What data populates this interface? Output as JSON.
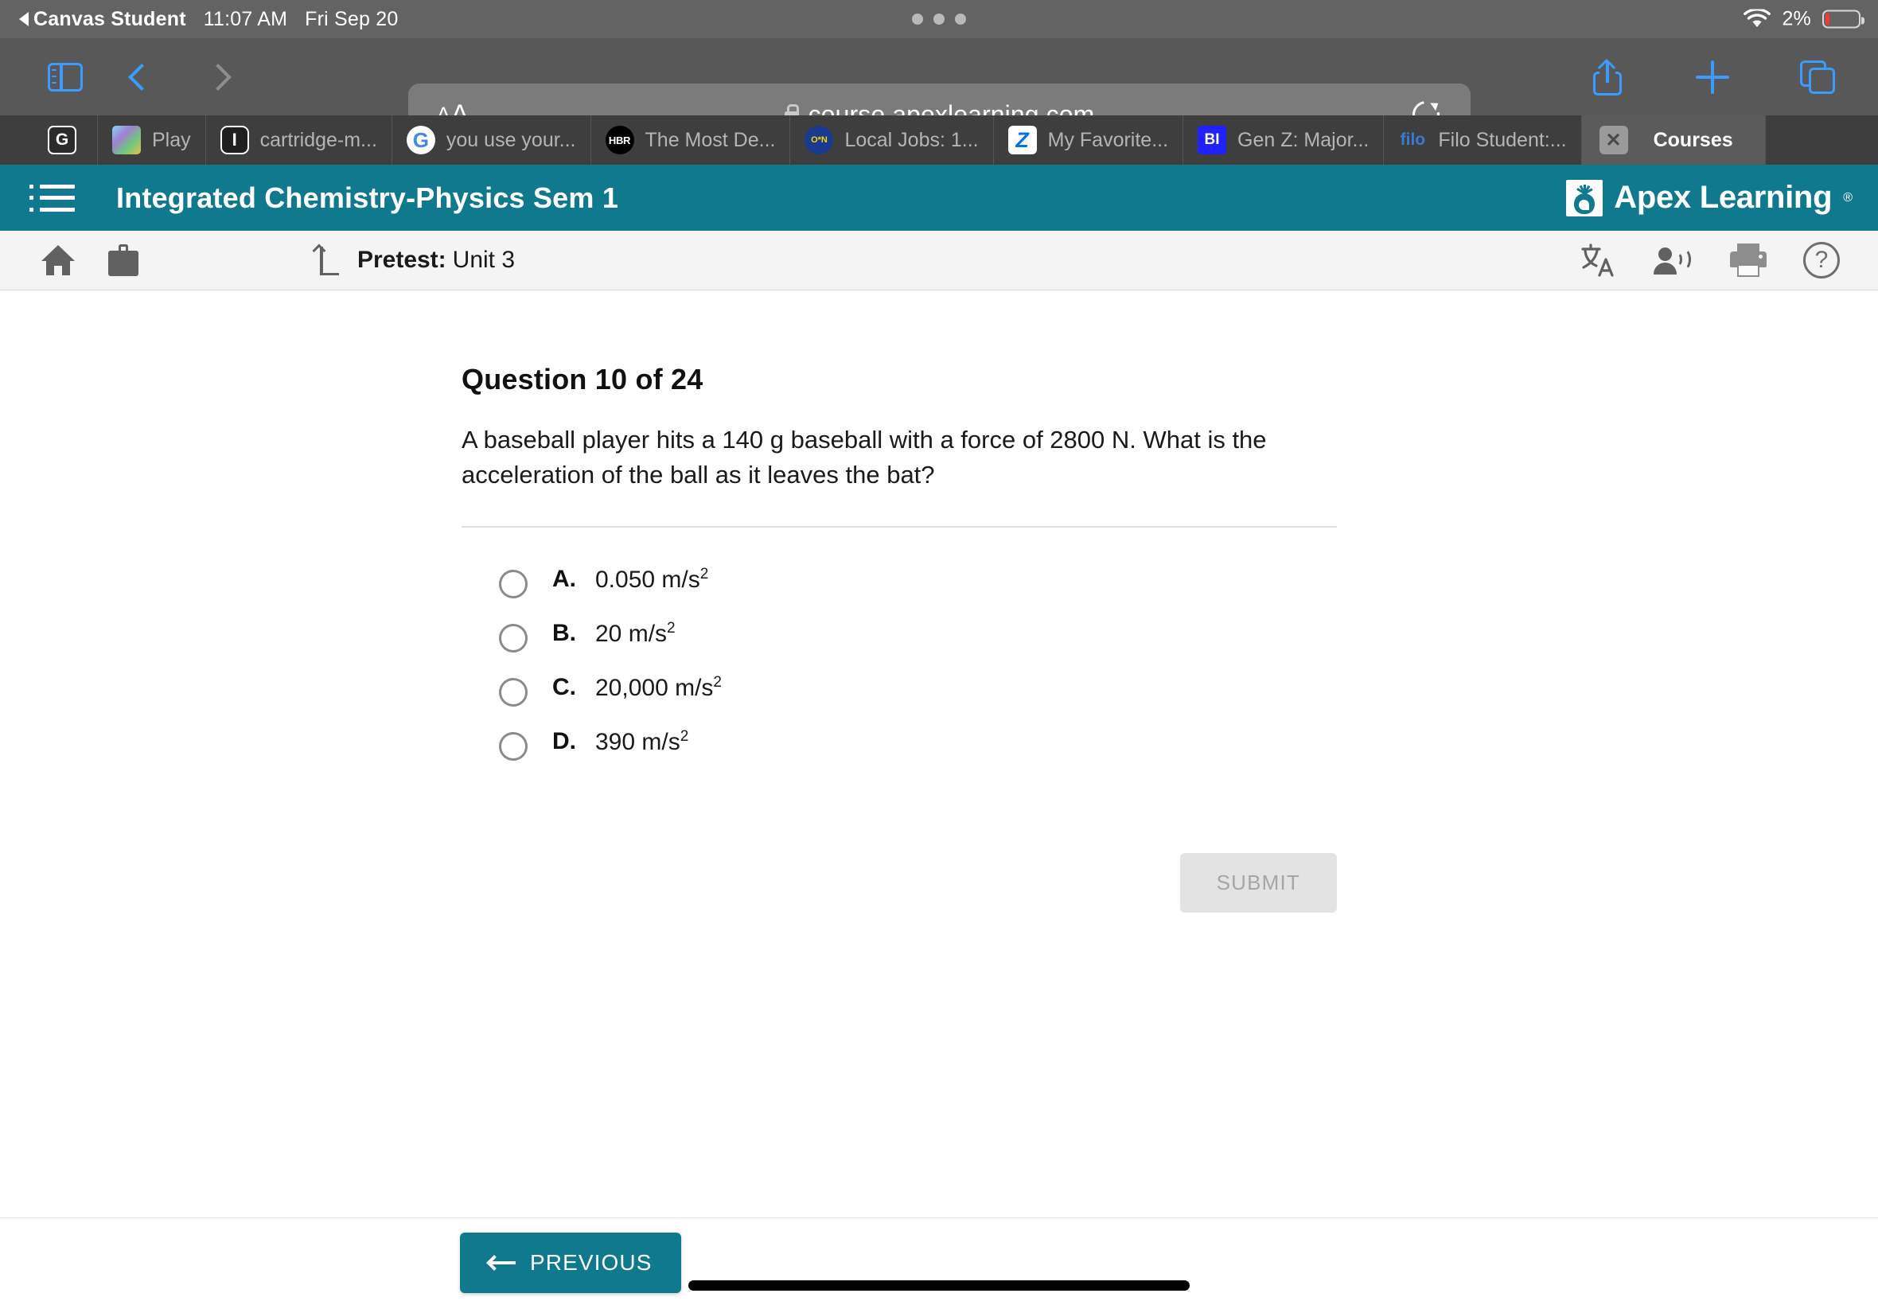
{
  "status_bar": {
    "back_app": "Canvas Student",
    "time": "11:07 AM",
    "date": "Fri Sep 20",
    "battery_percent": "2%",
    "wifi_icon": "wifi-icon",
    "battery_icon": "battery-icon"
  },
  "browser": {
    "url": "course.apexlearning.com",
    "lock_icon": "lock-icon",
    "text_size_small": "A",
    "text_size_large": "A",
    "sidebar_icon": "sidebar-icon",
    "back_icon": "chevron-left-icon",
    "forward_icon": "chevron-right-icon",
    "reload_icon": "reload-icon",
    "share_icon": "share-icon",
    "new_tab_icon": "plus-icon",
    "tabs_icon": "tabs-overview-icon",
    "tabs": [
      {
        "title": "",
        "favicon": "google-g-favicon",
        "active": false
      },
      {
        "title": "Play",
        "favicon": "image-thumbnail-favicon",
        "active": false
      },
      {
        "title": "cartridge-m...",
        "favicon": "instructure-favicon",
        "active": false
      },
      {
        "title": "you use your...",
        "favicon": "google-favicon",
        "active": false
      },
      {
        "title": "The Most De...",
        "favicon": "hbr-favicon",
        "active": false
      },
      {
        "title": "Local Jobs: 1...",
        "favicon": "onet-favicon",
        "active": false
      },
      {
        "title": "My Favorite...",
        "favicon": "zillow-favicon",
        "active": false
      },
      {
        "title": "Gen Z: Major...",
        "favicon": "business-insider-favicon",
        "active": false
      },
      {
        "title": "Filo Student:...",
        "favicon": "filo-favicon",
        "active": false
      },
      {
        "title": "Courses",
        "favicon": "close-icon",
        "active": true
      }
    ]
  },
  "apex_header": {
    "menu_icon": "hamburger-menu-icon",
    "course_title": "Integrated Chemistry-Physics Sem 1",
    "logo_text": "Apex Learning",
    "logo_trademark": "®",
    "brand_color": "#11798d"
  },
  "sub_nav": {
    "home_icon": "home-icon",
    "briefcase_icon": "briefcase-icon",
    "activity_icon": "pretest-arrow-icon",
    "activity_type": "Pretest:",
    "activity_name": "Unit 3",
    "translate_icon": "translate-icon",
    "read_aloud_icon": "read-aloud-icon",
    "print_icon": "print-icon",
    "help_icon": "help-icon"
  },
  "question": {
    "heading": "Question 10 of 24",
    "number": 10,
    "total": 24,
    "text": "A baseball player hits a 140 g baseball with a force of 2800 N. What is the acceleration of the ball as it leaves the bat?",
    "options": [
      {
        "letter": "A.",
        "value": "0.050 m/s",
        "exponent": "2",
        "selected": false
      },
      {
        "letter": "B.",
        "value": "20 m/s",
        "exponent": "2",
        "selected": false
      },
      {
        "letter": "C.",
        "value": "20,000 m/s",
        "exponent": "2",
        "selected": false
      },
      {
        "letter": "D.",
        "value": "390 m/s",
        "exponent": "2",
        "selected": false
      }
    ],
    "submit_label": "SUBMIT",
    "submit_enabled": false
  },
  "footer": {
    "previous_label": "PREVIOUS",
    "previous_arrow_icon": "arrow-left-icon",
    "home_indicator": "home-indicator"
  }
}
